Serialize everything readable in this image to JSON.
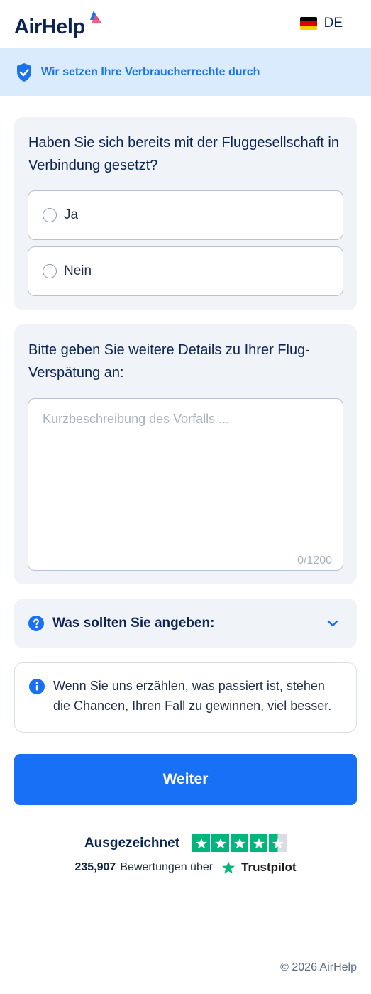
{
  "header": {
    "logo_text": "AirHelp",
    "language_code": "DE",
    "flag_colors": [
      "#000000",
      "#dd0000",
      "#ffce00"
    ]
  },
  "banner": {
    "icon": "shield-check-icon",
    "text": "Wir setzen Ihre Verbraucherrechte durch"
  },
  "contact_question": {
    "title": "Haben Sie sich bereits mit der Fluggesellschaft in Verbindung gesetzt?",
    "options": [
      {
        "label": "Ja"
      },
      {
        "label": "Nein"
      }
    ]
  },
  "details": {
    "title": "Bitte geben Sie weitere Details zu Ihrer Flug-Verspätung an:",
    "placeholder": "Kurzbeschreibung des Vorfalls ...",
    "value": "",
    "counter": "0/1200"
  },
  "accordion": {
    "icon": "question-circle-icon",
    "label": "Was sollten Sie angeben:",
    "chevron": "chevron-down-icon"
  },
  "info": {
    "icon": "info-circle-icon",
    "text": "Wenn Sie uns erzählen, was passiert ist, stehen die Chancen, Ihren Fall zu gewinnen, viel besser."
  },
  "continue_button": {
    "label": "Weiter"
  },
  "trustpilot": {
    "rating_label": "Ausgezeichnet",
    "stars": 4.5,
    "review_count": "235,907",
    "reviews_text": "Bewertungen über",
    "brand": "Trustpilot",
    "color": "#00b67a"
  },
  "footer": {
    "copyright": "© 2026 AirHelp"
  },
  "colors": {
    "primary": "#1770f5",
    "navy": "#0b2451",
    "banner_bg": "#d9ebfc",
    "card_bg": "#f0f3f8"
  }
}
